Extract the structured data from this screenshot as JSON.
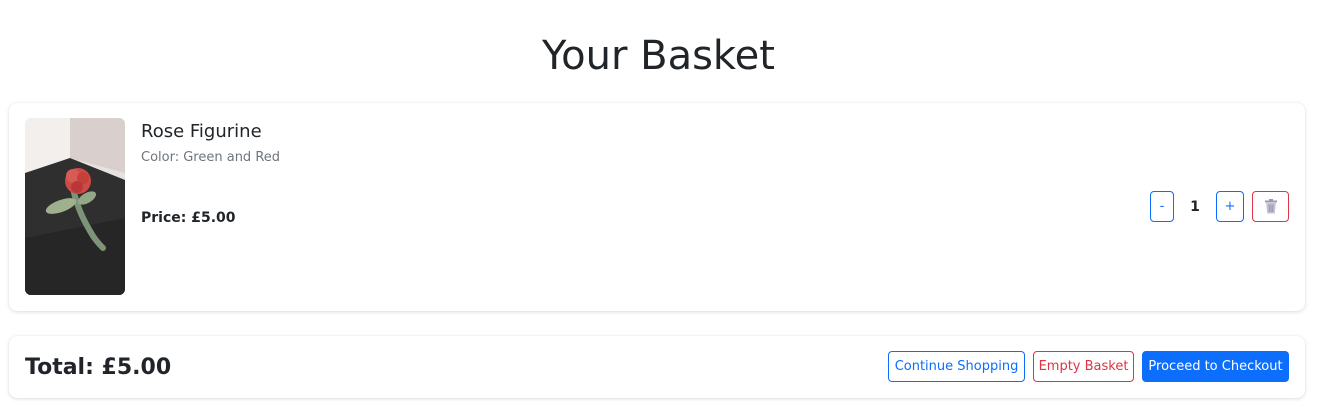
{
  "page": {
    "title": "Your Basket"
  },
  "item": {
    "name": "Rose Figurine",
    "color": "Color: Green and Red",
    "price": "Price: £5.00",
    "quantity": "1",
    "decrement_label": "-",
    "increment_label": "+",
    "image_icon": "rose-figurine-photo",
    "remove_icon": "trash-icon"
  },
  "summary": {
    "total": "Total: £5.00",
    "continue_label": "Continue Shopping",
    "empty_label": "Empty Basket",
    "checkout_label": "Proceed to Checkout"
  },
  "colors": {
    "primary": "#0d6efd",
    "danger": "#dc3545",
    "muted": "#6c757d",
    "text": "#212529"
  }
}
